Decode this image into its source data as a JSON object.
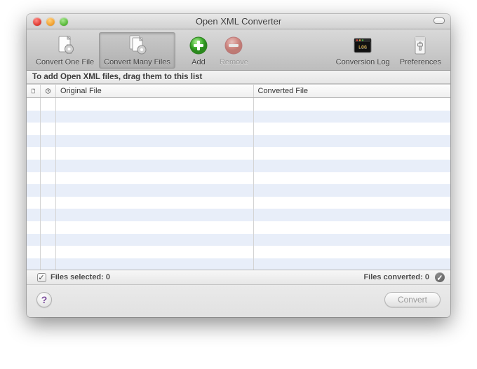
{
  "window": {
    "title": "Open XML Converter"
  },
  "toolbar": {
    "convert_one": "Convert One File",
    "convert_many": "Convert Many Files",
    "add": "Add",
    "remove": "Remove",
    "conversion_log": "Conversion Log",
    "preferences": "Preferences"
  },
  "hint": "To add Open XML files, drag them to this list",
  "columns": {
    "original": "Original File",
    "converted": "Converted File"
  },
  "status": {
    "selected_label": "Files selected:",
    "selected_count": "0",
    "converted_label": "Files converted:",
    "converted_count": "0",
    "check_glyph": "✓",
    "dot_glyph": "✓"
  },
  "footer": {
    "help_glyph": "?",
    "convert_label": "Convert"
  },
  "icons": {
    "doc_glyph": "",
    "clock_glyph": ""
  }
}
